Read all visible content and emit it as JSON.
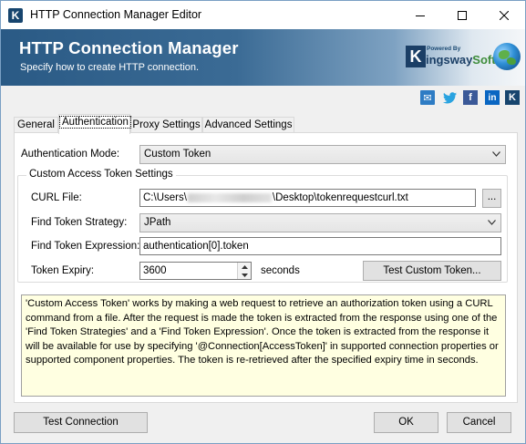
{
  "window": {
    "title": "HTTP Connection Manager Editor",
    "app_icon_letter": "K"
  },
  "banner": {
    "title": "HTTP Connection Manager",
    "subtitle": "Specify how to create HTTP connection.",
    "logo_powered": "Powered By",
    "logo_k": "K",
    "logo_name_1": "ingsway",
    "logo_name_2": "Soft"
  },
  "social": {
    "mail": "✉",
    "twitter": "🐦",
    "facebook": "f",
    "linkedin": "in",
    "kingsway": "K"
  },
  "tabs": [
    {
      "label": "General"
    },
    {
      "label": "Authentication"
    },
    {
      "label": "Proxy Settings"
    },
    {
      "label": "Advanced Settings"
    }
  ],
  "auth": {
    "mode_label": "Authentication Mode:",
    "mode_value": "Custom Token",
    "group_title": "Custom Access Token Settings",
    "curl_label": "CURL File:",
    "curl_prefix": "C:\\Users\\",
    "curl_suffix": "\\Desktop\\tokenrequestcurl.txt",
    "browse_label": "...",
    "strategy_label": "Find Token Strategy:",
    "strategy_value": "JPath",
    "expression_label": "Find Token Expression:",
    "expression_value": "authentication[0].token",
    "expiry_label": "Token Expiry:",
    "expiry_value": "3600",
    "expiry_unit": "seconds",
    "test_token_label": "Test Custom Token..."
  },
  "description": "'Custom Access Token' works by making a web request to retrieve an authorization token using a CURL command from a file. After the request is made the token is extracted from the response using one of the 'Find Token Strategies' and a 'Find Token Expression'. Once the token is extracted from the response it will be available for use by specifying '@Connection[AccessToken]' in supported connection properties or supported component properties. The token is re-retrieved after the specified expiry time in seconds.",
  "footer": {
    "test_connection_label": "Test Connection",
    "ok_label": "OK",
    "cancel_label": "Cancel"
  }
}
